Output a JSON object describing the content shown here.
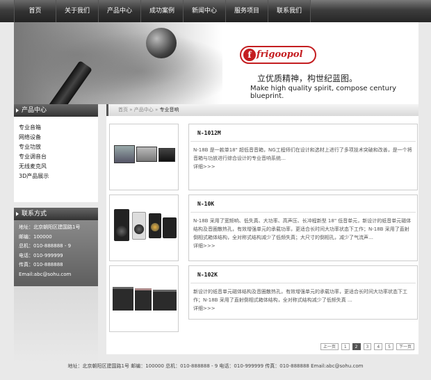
{
  "nav": {
    "items": [
      "首页",
      "关于我们",
      "产品中心",
      "成功案例",
      "新闻中心",
      "服务项目",
      "联系我们"
    ]
  },
  "banner": {
    "logo_text": "frigoopol",
    "slogan_cn": "立优质精神，构世纪蓝图。",
    "slogan_en": "Make high quality spirit, compose century blueprint."
  },
  "sidebar": {
    "products_title": "产品中心",
    "products": [
      "专业音箱",
      "网络设备",
      "专业功放",
      "专业调音台",
      "无线麦克风",
      "3D产品展示"
    ],
    "contact_title": "联系方式",
    "contact": [
      "地址：北京朝阳区建国路1号",
      "邮编：100000",
      "总机：010-888888 - 9",
      "电话：010-999999",
      "传真：010-888888",
      "Email:abc@sohu.com"
    ]
  },
  "breadcrumb": {
    "home": "首页",
    "sep": "»",
    "section": "产品中心",
    "current": "专业音响"
  },
  "products": [
    {
      "title": "N-1012M",
      "desc": "N-18B 是一款单18\" 超低音音箱，NG工程师们在设计和选材上进行了多项技术突破和改善，是一个将音箱与功放进行综合设计的专业音响系统…",
      "more": "详细>>>"
    },
    {
      "title": "N-10K",
      "desc": "N-18B 采用了宽频响、低失真、大功率、高声压、长冲程新型 18\" 低音单元，新设计的纸音单元磁体结构及音圈散热孔，有效增强单元的承载功率，更适合长时间大功率状态下工作；N-18B 采用了直射倒相式箱体结构，全对称式结构减少了低频失真；大尺寸的倒相孔，减少了气流声…",
      "more": "详细>>>"
    },
    {
      "title": "N-102K",
      "desc": "新设计的纸音单元磁体结构及音圈散热孔，有效增强单元的承载功率，更适合长时间大功率状态下工作；N-18B 采用了直射倒相式箱体结构，全对称式结构减少了低频失真 …",
      "more": "详细>>>"
    }
  ],
  "pagination": {
    "prev": "上一页",
    "pages": [
      "1",
      "2",
      "3",
      "4",
      "5"
    ],
    "active": "2",
    "next": "下一页"
  },
  "footer": {
    "text": "地址：北京朝阳区建国路1号 邮编：100000 总机：010-888888 - 9 电话：010-999999 传真：010-888888 Email:abc@sohu.com"
  }
}
